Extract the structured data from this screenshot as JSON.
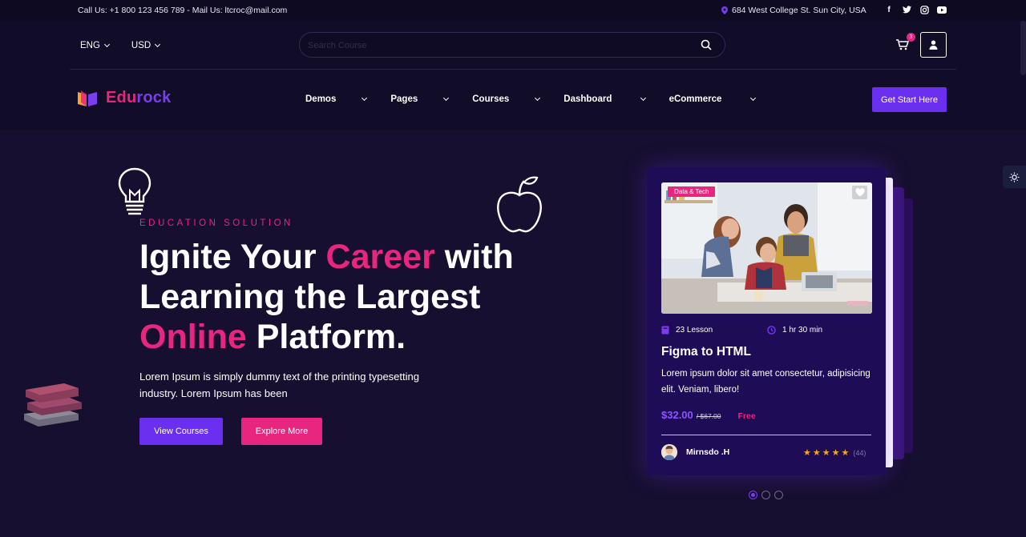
{
  "topbar": {
    "contact": "Call Us: +1 800 123 456 789 - Mail Us: ltcroc@mail.com",
    "address": "684 West College St. Sun City, USA",
    "social_icons": [
      "facebook-icon",
      "twitter-icon",
      "instagram-icon",
      "youtube-icon"
    ]
  },
  "header": {
    "language": "ENG",
    "currency": "USD",
    "search_placeholder": "Search Course",
    "cart_count": "3",
    "brand_part1": "Edu",
    "brand_part2": "rock",
    "nav": [
      "Demos",
      "Pages",
      "Courses",
      "Dashboard",
      "eCommerce"
    ],
    "cta": "Get Start Here"
  },
  "hero": {
    "eyebrow": "EDUCATION SOLUTION",
    "headline_1": "Ignite Your ",
    "headline_2": "Career",
    "headline_3": " with Learning the Largest ",
    "headline_4": "Online",
    "headline_5": " Platform.",
    "description": "Lorem Ipsum is simply dummy text of the printing typesetting industry. Lorem Ipsum has been",
    "primary_button": "View Courses",
    "secondary_button": "Explore More"
  },
  "course_card": {
    "tag": "Data & Tech",
    "lessons": "23 Lesson",
    "duration": "1 hr 30 min",
    "title": "Figma to HTML",
    "description": "Lorem ipsum dolor sit amet consectetur, adipisicing elit. Veniam, libero!",
    "price": "$32.00",
    "old_price": "/ $67.00",
    "free_label": "Free",
    "author": "Mirnsdo .H",
    "rating": 5,
    "reviews": "(44)"
  },
  "slider": {
    "total": 3,
    "active": 1
  },
  "colors": {
    "background": "#170f30",
    "accent_purple": "#6b2ff0",
    "accent_pink": "#e8257f",
    "card": "#1f0c57"
  }
}
